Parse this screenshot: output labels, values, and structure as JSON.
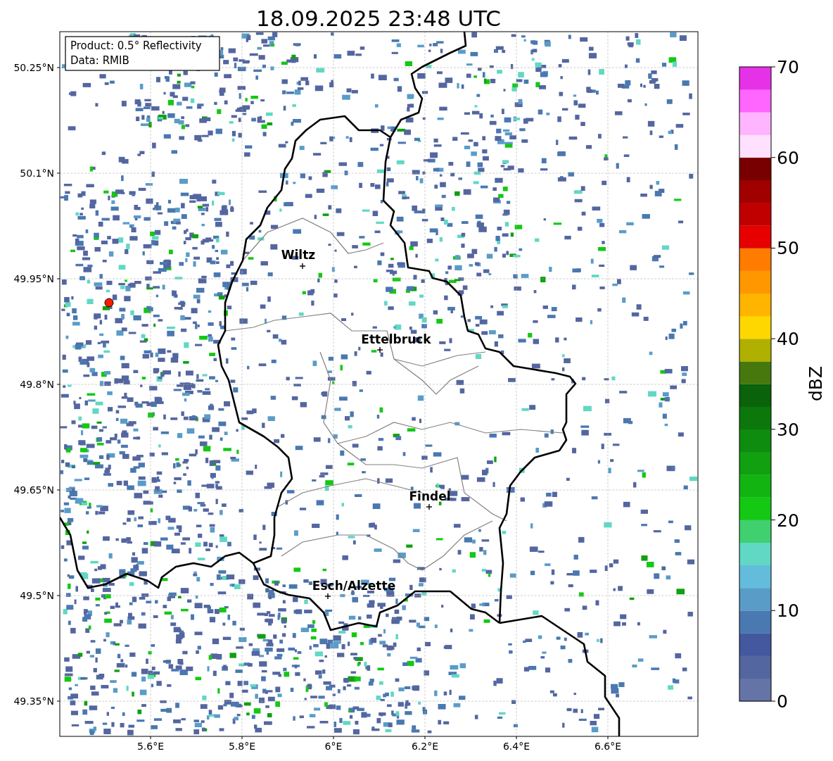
{
  "title": "18.09.2025 23:48 UTC",
  "info_box": {
    "lines": [
      "Product: 0.5° Reflectivity",
      "Data: RMIB"
    ]
  },
  "map": {
    "latitude_ticks": [
      "50.25°N",
      "50.1°N",
      "49.95°N",
      "49.8°N",
      "49.65°N",
      "49.5°N",
      "49.35°N"
    ],
    "longitude_ticks": [
      "5.6°E",
      "5.8°E",
      "6°E",
      "6.2°E",
      "6.4°E",
      "6.6°E"
    ],
    "places": [
      {
        "name": "Wiltz"
      },
      {
        "name": "Ettelbruck"
      },
      {
        "name": "Findel"
      },
      {
        "name": "Esch/Alzette"
      }
    ]
  },
  "colorbar": {
    "label": "dBZ",
    "ticks": [
      "70",
      "60",
      "50",
      "40",
      "30",
      "20",
      "10",
      "0"
    ],
    "steps": [
      {
        "color": "#6474a6"
      },
      {
        "color": "#5466a0"
      },
      {
        "color": "#4458a0"
      },
      {
        "color": "#4a78b0"
      },
      {
        "color": "#5a9cc8"
      },
      {
        "color": "#64bcdc"
      },
      {
        "color": "#60d8c4"
      },
      {
        "color": "#40d070"
      },
      {
        "color": "#14c814"
      },
      {
        "color": "#12b412"
      },
      {
        "color": "#10a010"
      },
      {
        "color": "#0e8c10"
      },
      {
        "color": "#0c780c"
      },
      {
        "color": "#0a620a"
      },
      {
        "color": "#46780e"
      },
      {
        "color": "#b0b000"
      },
      {
        "color": "#ffd700"
      },
      {
        "color": "#ffb400"
      },
      {
        "color": "#ff9800"
      },
      {
        "color": "#ff7c00"
      },
      {
        "color": "#e60000"
      },
      {
        "color": "#c00000"
      },
      {
        "color": "#a00000"
      },
      {
        "color": "#780000"
      },
      {
        "color": "#ffe0ff"
      },
      {
        "color": "#ffb4ff"
      },
      {
        "color": "#ff66ff"
      },
      {
        "color": "#e632e6"
      }
    ]
  }
}
